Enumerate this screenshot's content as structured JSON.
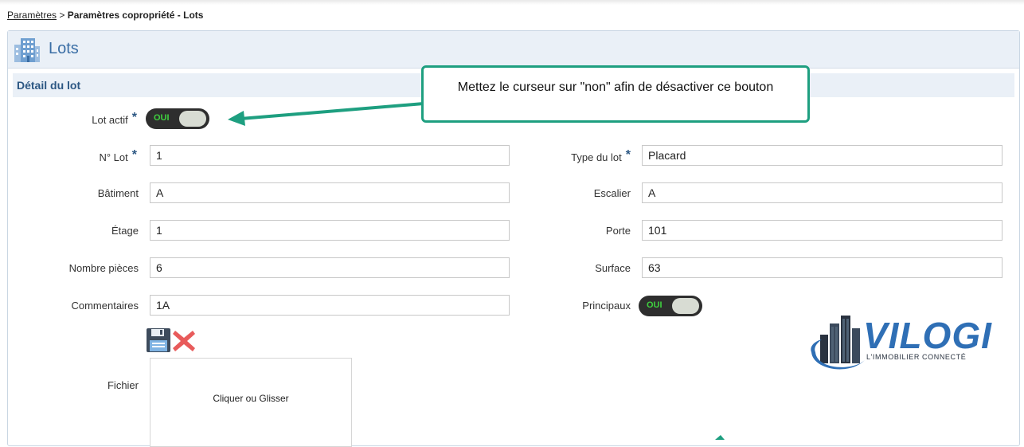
{
  "breadcrumb": {
    "link": "Paramètres",
    "separator": " > ",
    "current": "Paramètres copropriété - Lots"
  },
  "header": {
    "title": "Lots",
    "icon": "building-icon"
  },
  "section": {
    "title": "Détail du lot"
  },
  "fields": {
    "lot_actif": {
      "label": "Lot actif",
      "toggle": "OUI",
      "required": "*"
    },
    "n_lot": {
      "label": "N° Lot",
      "value": "1",
      "required": "*"
    },
    "type_lot": {
      "label": "Type du lot",
      "value": "Placard",
      "required": "*"
    },
    "batiment": {
      "label": "Bâtiment",
      "value": "A"
    },
    "escalier": {
      "label": "Escalier",
      "value": "A"
    },
    "etage": {
      "label": "Étage",
      "value": "1"
    },
    "porte": {
      "label": "Porte",
      "value": "101"
    },
    "nombre_pieces": {
      "label": "Nombre pièces",
      "value": "6"
    },
    "surface": {
      "label": "Surface",
      "value": "63"
    },
    "commentaires": {
      "label": "Commentaires",
      "value": "1A"
    },
    "principaux": {
      "label": "Principaux",
      "toggle": "OUI"
    },
    "fichier": {
      "label": "Fichier",
      "dropzone": "Cliquer ou Glisser"
    }
  },
  "callout": {
    "text": "Mettez le curseur sur \"non\" afin de désactiver ce bouton",
    "color": "#1e9f80"
  },
  "logo": {
    "name": "VILOGI",
    "tagline": "L'IMMOBILIER CONNECTÉ",
    "color": "#2f6fb5",
    "dark": "#2a3340"
  },
  "colors": {
    "accent": "#3a6ea5",
    "toggle_on": "#3fd13f",
    "header_bg": "#eaf0f7"
  }
}
